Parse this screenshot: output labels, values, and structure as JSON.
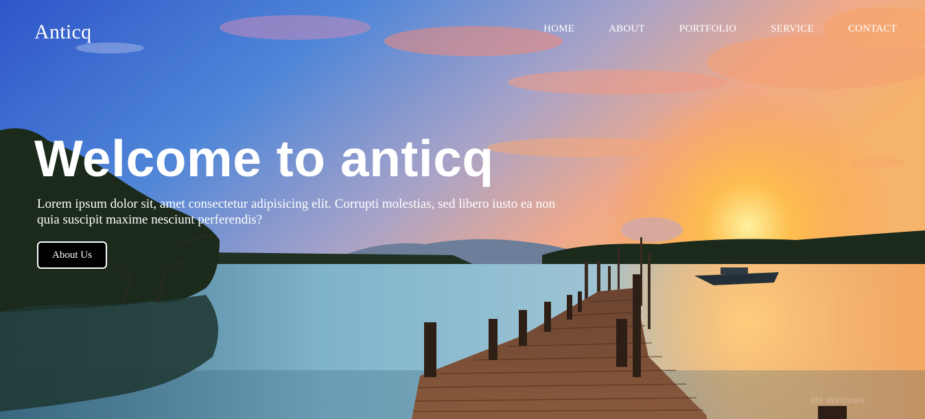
{
  "site": {
    "brand": "Anticq"
  },
  "nav": {
    "items": [
      {
        "label": "HOME"
      },
      {
        "label": "ABOUT"
      },
      {
        "label": "PORTFOLIO"
      },
      {
        "label": "SERVICE"
      },
      {
        "label": "CONTACT"
      }
    ]
  },
  "hero": {
    "title": "Welcome to anticq",
    "description": "Lorem ipsum dolor sit, amet consectetur adipisicing elit. Corrupti molestias, sed libero iusto ea non quia suscipit maxime nesciunt perferendis?",
    "button_label": "About Us",
    "background": "sunset-lake-pier-photo"
  },
  "watermark": {
    "text": "ate Windows"
  },
  "colors": {
    "text": "#ffffff",
    "button_bg": "#000000",
    "button_border": "#ffffff"
  }
}
